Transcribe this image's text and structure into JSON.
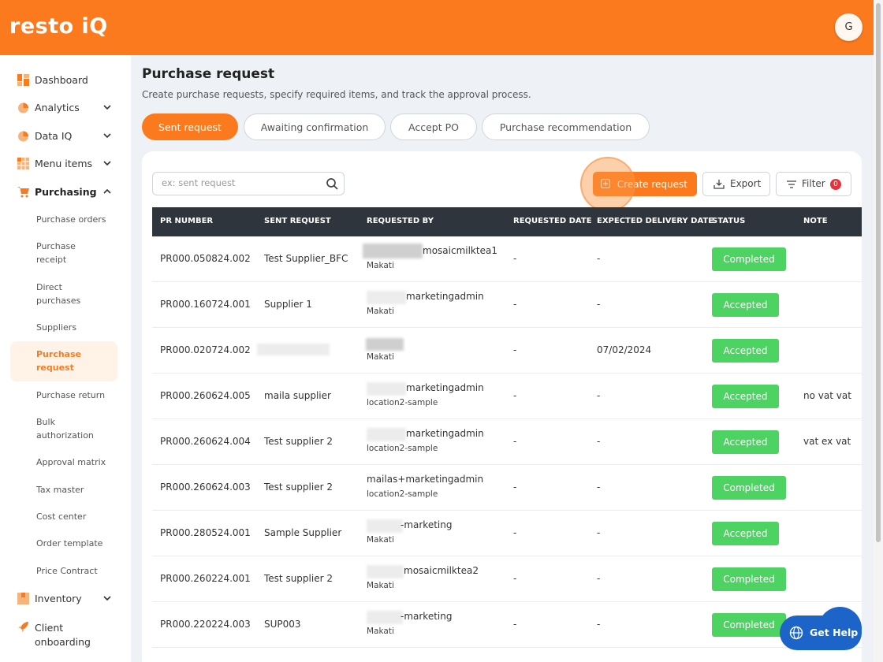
{
  "app": {
    "logo": "resto iQ",
    "avatar_initial": "G"
  },
  "sidebar": {
    "items": [
      {
        "label": "Dashboard",
        "icon": "dashboard-icon",
        "chevron": ""
      },
      {
        "label": "Analytics",
        "icon": "pie-chart-icon",
        "chevron": "down"
      },
      {
        "label": "Data IQ",
        "icon": "pie-chart-icon",
        "chevron": "down"
      },
      {
        "label": "Menu items",
        "icon": "grid-icon",
        "chevron": "down"
      },
      {
        "label": "Purchasing",
        "icon": "cart-icon",
        "chevron": "up"
      },
      {
        "label": "Inventory",
        "icon": "box-icon",
        "chevron": "down"
      },
      {
        "label": "Client onboarding",
        "icon": "rocket-icon",
        "chevron": ""
      }
    ],
    "purchasing_sub": [
      "Purchase orders",
      "Purchase receipt",
      "Direct purchases",
      "Suppliers",
      "Purchase request",
      "Purchase return",
      "Bulk authorization",
      "Approval matrix",
      "Tax master",
      "Cost center",
      "Order template",
      "Price Contract"
    ],
    "active_sub": "Purchase request"
  },
  "page": {
    "title": "Purchase request",
    "subtitle": "Create purchase requests, specify required items, and track the approval process."
  },
  "tabs": [
    {
      "label": "Sent request",
      "active": true
    },
    {
      "label": "Awaiting confirmation",
      "active": false
    },
    {
      "label": "Accept PO",
      "active": false
    },
    {
      "label": "Purchase recommendation",
      "active": false
    }
  ],
  "toolbar": {
    "search_placeholder": "ex: sent request",
    "create_label": "Create request",
    "export_label": "Export",
    "filter_label": "Filter",
    "filter_count": "0"
  },
  "table": {
    "columns": [
      "PR NUMBER",
      "SENT REQUEST",
      "REQUESTED BY",
      "REQUESTED DATE",
      "EXPECTED DELIVERY DATE",
      "STATUS",
      "NOTE"
    ],
    "rows": [
      {
        "pr": "PR000.050824.002",
        "sent": "Test Supplier_BFC",
        "req_name": "mosaicmilktea1",
        "req_loc": "Makati",
        "req_date": "-",
        "exp_date": "-",
        "status": "Completed",
        "note": ""
      },
      {
        "pr": "PR000.160724.001",
        "sent": "Supplier 1",
        "req_name": "marketingadmin",
        "req_loc": "Makati",
        "req_date": "-",
        "exp_date": "-",
        "status": "Accepted",
        "note": ""
      },
      {
        "pr": "PR000.020724.002",
        "sent": "",
        "req_name": "",
        "req_loc": "Makati",
        "req_date": "-",
        "exp_date": "07/02/2024",
        "status": "Accepted",
        "note": ""
      },
      {
        "pr": "PR000.260624.005",
        "sent": "maila supplier",
        "req_name": "marketingadmin",
        "req_loc": "location2-sample",
        "req_date": "-",
        "exp_date": "-",
        "status": "Accepted",
        "note": "no vat vat"
      },
      {
        "pr": "PR000.260624.004",
        "sent": "Test supplier 2",
        "req_name": "marketingadmin",
        "req_loc": "location2-sample",
        "req_date": "-",
        "exp_date": "-",
        "status": "Accepted",
        "note": "vat ex vat"
      },
      {
        "pr": "PR000.260624.003",
        "sent": "Test supplier 2",
        "req_name": "mailas+marketingadmin",
        "req_loc": "location2-sample",
        "req_date": "-",
        "exp_date": "-",
        "status": "Completed",
        "note": ""
      },
      {
        "pr": "PR000.280524.001",
        "sent": "Sample Supplier",
        "req_name": "-marketing",
        "req_loc": "Makati",
        "req_date": "-",
        "exp_date": "-",
        "status": "Accepted",
        "note": ""
      },
      {
        "pr": "PR000.260224.001",
        "sent": "Test supplier 2",
        "req_name": "mosaicmilktea2",
        "req_loc": "Makati",
        "req_date": "-",
        "exp_date": "-",
        "status": "Completed",
        "note": ""
      },
      {
        "pr": "PR000.220224.003",
        "sent": "SUP003",
        "req_name": "-marketing",
        "req_loc": "Makati",
        "req_date": "-",
        "exp_date": "-",
        "status": "Completed",
        "note": ""
      }
    ]
  },
  "help": {
    "label": "Get Help"
  },
  "colors": {
    "brand": "#fb7a1e",
    "status_green": "#4cd361",
    "header_dark": "#2f353d",
    "help_blue": "#1d64c9"
  }
}
